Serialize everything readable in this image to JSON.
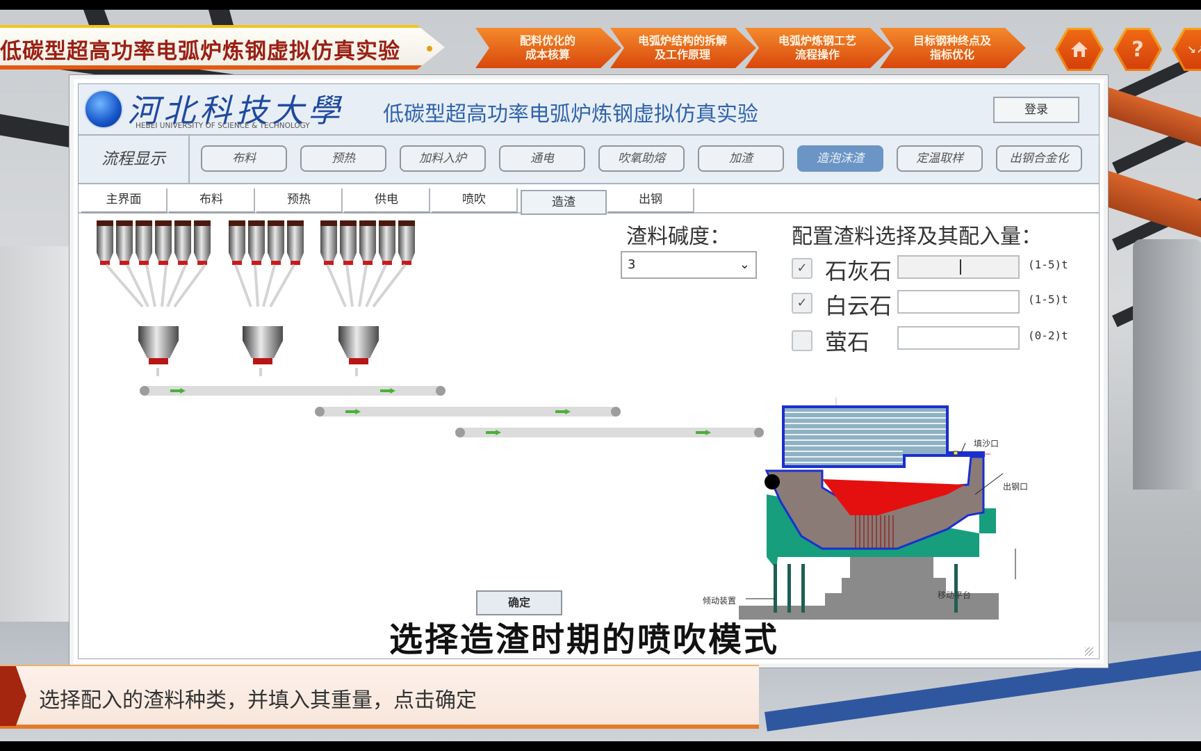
{
  "banner": {
    "title": "低碳型超高功率电弧炉炼钢虚拟仿真实验"
  },
  "top_nav": [
    {
      "line1": "配料优化的",
      "line2": "成本核算"
    },
    {
      "line1": "电弧炉结构的拆解",
      "line2": "及工作原理"
    },
    {
      "line1": "电弧炉炼钢工艺",
      "line2": "流程操作"
    },
    {
      "line1": "目标钢种终点及",
      "line2": "指标优化"
    }
  ],
  "top_icons": {
    "home": "home-icon",
    "help": "question-icon",
    "collapse": "collapse-arrows-icon",
    "help_glyph": "?",
    "collapse_glyph": "↘↗"
  },
  "header": {
    "university_cn": "河北科技大學",
    "university_en": "HEBEI UNIVERSITY OF SCIENCE & TECHNOLOGY",
    "app_title": "低碳型超高功率电弧炉炼钢虚拟仿真实验",
    "login_label": "登录"
  },
  "flow": {
    "label": "流程显示",
    "steps": [
      "布料",
      "预热",
      "加料入炉",
      "通电",
      "吹氧助熔",
      "加渣",
      "造泡沫渣",
      "定温取样",
      "出钢合金化"
    ],
    "active_index": 6
  },
  "tabs": {
    "items": [
      "主界面",
      "布料",
      "预热",
      "供电",
      "喷吹",
      "造渣",
      "出钢"
    ],
    "active_index": 5
  },
  "form": {
    "basicity_label": "渣料碱度：",
    "basicity_value": "3",
    "config_label": "配置渣料选择及其配入量：",
    "materials": [
      {
        "name": "石灰石",
        "checked": true,
        "value": "",
        "range": "(1-5)t"
      },
      {
        "name": "白云石",
        "checked": true,
        "value": "",
        "range": "(1-5)t"
      },
      {
        "name": "萤石",
        "checked": false,
        "value": "",
        "range": "(0-2)t"
      }
    ],
    "confirm_label": "确定",
    "check_glyph": "✓"
  },
  "furnace_labels": {
    "sand_port": "填沙口",
    "tap_hole": "出钢口",
    "tilt_device": "倾动装置",
    "moving_platform": "移动平台"
  },
  "subtitle": "选择造渣时期的喷吹模式",
  "hint": "选择配入的渣料种类，并填入其重量，点击确定"
}
